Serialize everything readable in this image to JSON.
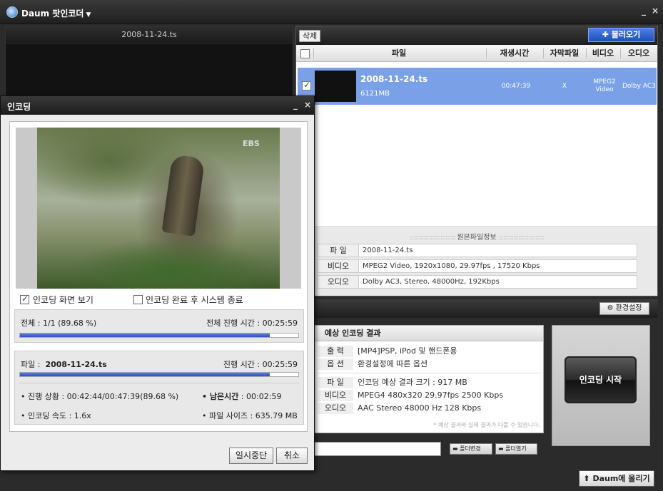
{
  "app": {
    "title": "Daum 팟인코더",
    "minimize": "_",
    "close": "×"
  },
  "preview": {
    "filename": "2008-11-24.ts"
  },
  "file_panel": {
    "delete_label": "삭제",
    "load_label": "불러오기",
    "columns": [
      "파일",
      "재생시간",
      "자막파일",
      "비디오",
      "오디오"
    ],
    "rows": [
      {
        "name": "2008-11-24.ts",
        "size": "6121MB",
        "duration": "00:47:39",
        "subtitle": "X",
        "video_line1": "MPEG2",
        "video_line2": "Video",
        "audio": "Dolby AC3"
      }
    ],
    "info_title": "원본파일정보",
    "info": [
      {
        "label": "파 일",
        "value": "2008-11-24.ts"
      },
      {
        "label": "비디오",
        "value": "MPEG2 Video, 1920x1080, 29.97fps , 17520 Kbps"
      },
      {
        "label": "오디오",
        "value": "Dolby AC3, Stereo, 48000Hz, 192Kbps"
      }
    ]
  },
  "settings_label": "환경설정",
  "result": {
    "title": "예상 인코딩 결과",
    "output_label": "출 력",
    "output_value": "[MP4]PSP, iPod 및 핸드폰용",
    "option_label": "옵 션",
    "option_value": "환경설정에 따른 옵션",
    "file_label": "파 일",
    "file_value": "인코딩 예상 결과 크기 : 917 MB",
    "video_label": "비디오",
    "video_value": "MPEG4 480x320 29.97fps   2500 Kbps",
    "audio_label": "오디오",
    "audio_value": "AAC Stereo 48000 Hz 128 Kbps",
    "note": "* 예상 결과와 실제 결과가 다를 수 있습니다."
  },
  "start_label": "인코딩 시작",
  "folder_change_label": "폴더변경",
  "folder_open_label": "폴더열기",
  "upload_label": "Daum에 올리기",
  "dialog": {
    "title": "인코딩",
    "minimize": "_",
    "close": "×",
    "watermark": "EBS",
    "show_screen_label": "인코딩 화면 보기",
    "show_screen_checked": true,
    "shutdown_label": "인코딩 완료 후 시스템 종료",
    "shutdown_checked": false,
    "total_label": "전체 : 1/1 (89.68 %)",
    "total_time": "전체 진행 시간 : 00:25:59",
    "total_progress": 0.8968,
    "file_prefix": "파일 :",
    "file_name": "2008-11-24.ts",
    "file_time": "진행 시간 : 00:25:59",
    "file_progress": 0.8968,
    "status": "• 진행 상황 : 00:42:44/00:47:39(89.68 %)",
    "remaining_label": "• 남은시간",
    "remaining_value": ": 00:02:59",
    "speed": "• 인코딩 속도 : 1.6x",
    "filesize": "• 파일 사이즈 : 635.79 MB",
    "pause_label": "일시중단",
    "cancel_label": "취소"
  }
}
